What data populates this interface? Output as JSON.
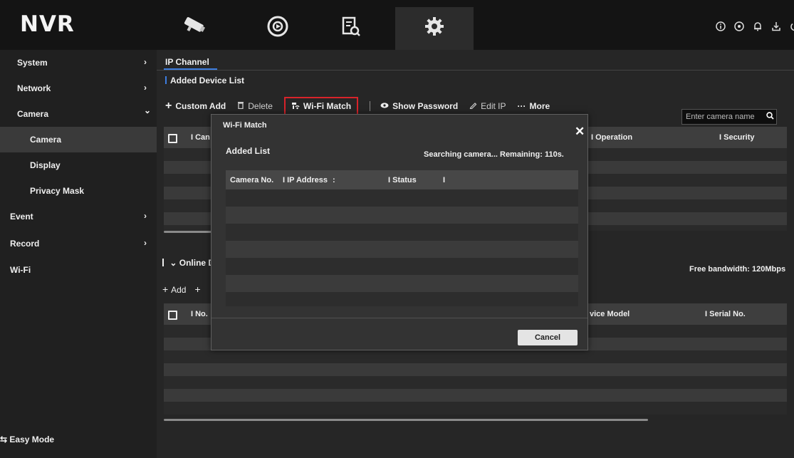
{
  "app": {
    "logo": "NVR"
  },
  "top_nav": {
    "icons": [
      "camera-icon",
      "playback-icon",
      "search-file-icon",
      "settings-gear-icon"
    ],
    "active_index": 3,
    "right_icons": [
      "info-icon",
      "status-icon",
      "bell-icon",
      "download-icon",
      "power-icon"
    ]
  },
  "sidebar": {
    "items": [
      {
        "label": "System",
        "arrow": "›"
      },
      {
        "label": "Network",
        "arrow": "›"
      },
      {
        "label": "Camera",
        "arrow": "⌄"
      },
      {
        "label": "Camera",
        "arrow": ""
      },
      {
        "label": "Display",
        "arrow": ""
      },
      {
        "label": "Privacy Mask",
        "arrow": ""
      },
      {
        "label": "Event",
        "arrow": "›"
      },
      {
        "label": "Record",
        "arrow": "›"
      },
      {
        "label": "Wi-Fi",
        "arrow": ""
      }
    ],
    "easy_mode": "⇆ Easy Mode"
  },
  "main": {
    "tab": "IP Channel",
    "added_device_list": "Added Device List",
    "toolbar": {
      "custom_add": "Custom Add",
      "delete": "Delete",
      "wifi_match": "Wi-Fi Match",
      "show_password": "Show Password",
      "edit_ip": "Edit IP",
      "more": "More"
    },
    "search_placeholder": "Enter camera name",
    "table1_headers": {
      "camera": "I Can",
      "operation": "I Operation",
      "security": "I Security"
    },
    "online_section": "Online D",
    "toolbar2": {
      "add": "Add",
      "plus": "+"
    },
    "table2_headers": {
      "no": "I No.",
      "device_model": "vice Model",
      "serial": "I Serial No."
    },
    "free_bandwidth": "Free bandwidth: 120Mbps"
  },
  "dialog": {
    "title": "Wi-Fi Match",
    "close": "✕",
    "added_list": "Added List",
    "status_text": "Searching camera... Remaining: 110s.",
    "headers": {
      "camera_no": "Camera No.",
      "ip_address": "I IP Address",
      "status": "I Status"
    },
    "cancel": "Cancel"
  }
}
